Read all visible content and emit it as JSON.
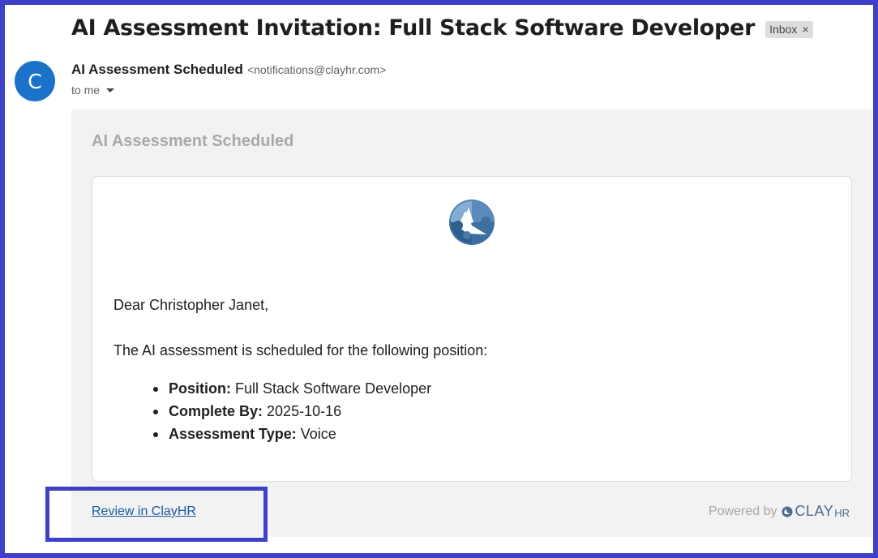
{
  "email": {
    "subject": "AI Assessment Invitation: Full Stack Software Developer",
    "label": "Inbox",
    "label_remove": "×",
    "avatar_letter": "C",
    "sender_name": "AI Assessment Scheduled",
    "sender_email": "<notifications@clayhr.com>",
    "recipient": "to me"
  },
  "body": {
    "heading": "AI Assessment Scheduled",
    "greeting": "Dear Christopher Janet,",
    "intro": "The AI assessment is scheduled for the following position:",
    "details": [
      {
        "label": "Position:",
        "value": "Full Stack Software Developer"
      },
      {
        "label": "Complete By:",
        "value": "2025-10-16"
      },
      {
        "label": "Assessment Type:",
        "value": "Voice"
      }
    ],
    "review_link": "Review in ClayHR",
    "powered_by": "Powered by",
    "brand_clay": "CLAY",
    "brand_hr": "HR"
  },
  "colors": {
    "accent_frame": "#3f3fc8",
    "avatar": "#1a73c8",
    "link": "#1a5a9e",
    "brand": "#4a6c8f"
  },
  "icons": [
    "clayhr-logo-icon",
    "dropdown-caret-icon",
    "close-icon",
    "clayhr-mini-logo-icon"
  ]
}
